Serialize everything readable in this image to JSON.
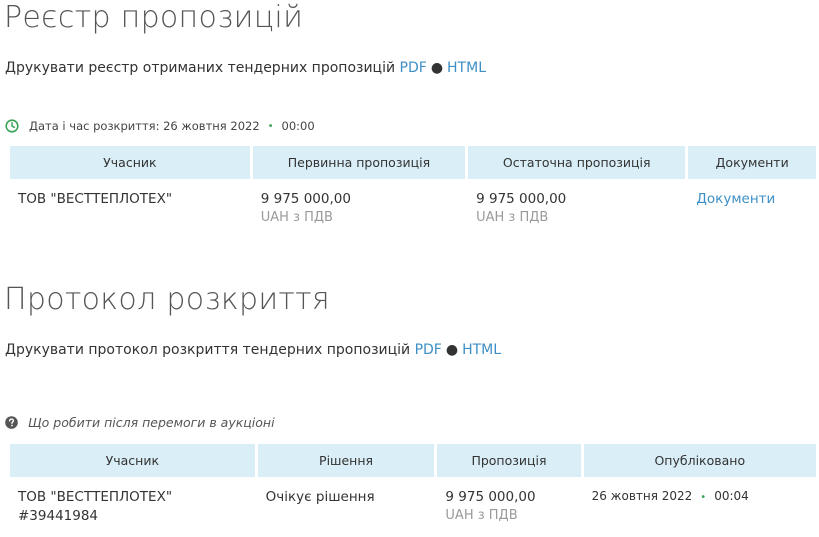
{
  "registry": {
    "title": "Реєстр пропозицій",
    "print_text": "Друкувати реєстр отриманих тендерних пропозицій",
    "pdf": "PDF",
    "dot": "●",
    "html": "HTML",
    "opening_label": "Дата і час розкриття: 26 жовтня 2022",
    "opening_sep": "•",
    "opening_time": "00:00",
    "headers": [
      "Учасник",
      "Первинна пропозиція",
      "Остаточна пропозиція",
      "Документи"
    ],
    "rows": [
      {
        "participant": "ТОВ \"ВЕСТТЕПЛОТЕХ\"",
        "initial_amount": "9 975 000,00",
        "initial_currency": "UAH з ПДВ",
        "final_amount": "9 975 000,00",
        "final_currency": "UAH з ПДВ",
        "documents_link": "Документи"
      }
    ]
  },
  "protocol": {
    "title": "Протокол розкриття",
    "print_text": "Друкувати протокол розкриття тендерних пропозицій",
    "pdf": "PDF",
    "dot": "●",
    "html": "HTML",
    "help_text": "Що робити після перемоги в аукціоні",
    "headers": [
      "Учасник",
      "Рішення",
      "Пропозиція",
      "Опубліковано"
    ],
    "rows": [
      {
        "participant": "ТОВ \"ВЕСТТЕПЛОТЕХ\"",
        "participant_id": "#39441984",
        "decision": "Очікує рішення",
        "amount": "9 975 000,00",
        "currency": "UAH з ПДВ",
        "published_date": "26 жовтня 2022",
        "published_sep": "•",
        "published_time": "00:04"
      }
    ]
  },
  "colors": {
    "accent": "#3d8fc6",
    "header_bg": "#d9eef6",
    "clock": "#3aa356"
  }
}
